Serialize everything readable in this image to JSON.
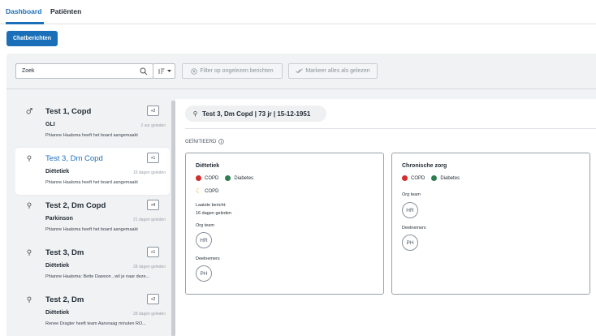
{
  "nav": {
    "tabs": [
      {
        "label": "Dashboard"
      },
      {
        "label": "Patiënten"
      }
    ]
  },
  "toolbar": {
    "chat_button": "Chatberichten",
    "search_value": "Zoek",
    "filter_unread": "Filter op ongelezen berichten",
    "mark_all_read": "Markeer alles als gelezen"
  },
  "conversations": [
    {
      "name": "Test 1, Copd",
      "count": "+2",
      "team": "GLI",
      "time": "2 uur geleden",
      "preview": "Phianne Haalsma heeft het board aangemaakt",
      "icon": "male-icon"
    },
    {
      "name": "Test 3, Dm Copd",
      "count": "+1",
      "team": "Diëtetiek",
      "time": "16 dagen geleden",
      "preview": "Phianne Haalsma heeft het board aangemaakt",
      "icon": "pin-icon",
      "selected": true
    },
    {
      "name": "Test 2, Dm Copd",
      "count": "+4",
      "team": "Parkinson",
      "time": "21 dagen geleden",
      "preview": "Phianne Haalsma heeft het board aangemaakt",
      "icon": "pin-icon"
    },
    {
      "name": "Test 3, Dm",
      "count": "+1",
      "team": "Diëtetiek",
      "time": "28 dagen geleden",
      "preview": "Phianne Haalsma: Bette Dawson , wil je naar deze...",
      "icon": "pin-icon"
    },
    {
      "name": "Test 2, Dm",
      "count": "+2",
      "team": "Diëtetiek",
      "time": "28 dagen geleden",
      "preview": "Renee Dragter heeft team Aanvraag minuten RO...",
      "icon": "pin-icon"
    }
  ],
  "detail": {
    "patient": "Test 3, Dm Copd | 73 jr | 15-12-1951",
    "section": "GEÏNITIEERD",
    "cards": [
      {
        "title": "Diëtetiek",
        "tags": [
          {
            "label": "COPD",
            "color": "#d32f2f"
          },
          {
            "label": "Diabetes",
            "color": "#2e7d4f"
          }
        ],
        "moon_tag": "COPD",
        "last_message_label": "Laatste bericht:",
        "last_message_time": "16 dagen geleden",
        "org_team_label": "Org team",
        "org_team_avatar": "HR",
        "participants_label": "Deelnemers",
        "participants_avatar": "PH"
      },
      {
        "title": "Chronische zorg",
        "tags": [
          {
            "label": "COPD",
            "color": "#d32f2f"
          },
          {
            "label": "Diabetes",
            "color": "#2e7d4f"
          }
        ],
        "org_team_label": "Org team",
        "org_team_avatar": "HR",
        "participants_label": "Deelnemers",
        "participants_avatar": "PH"
      }
    ]
  },
  "colors": {
    "accent": "#1a6fb8",
    "copd": "#d32f2f",
    "diabetes": "#2e7d4f",
    "moon": "#e8b000"
  }
}
